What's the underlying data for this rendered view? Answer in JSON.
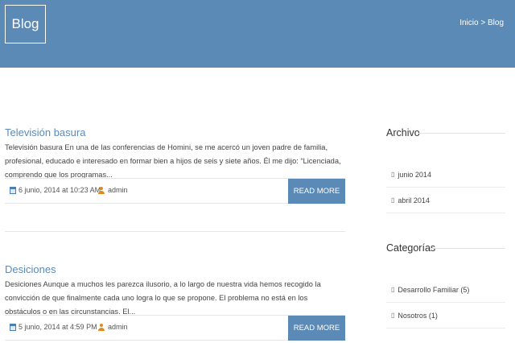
{
  "header": {
    "title": "Blog",
    "breadcrumb": {
      "home": "Inicio",
      "separator": " > ",
      "current": "Blog"
    }
  },
  "posts": [
    {
      "title": "Televisión basura",
      "excerpt": "Televisión basura En una de las conferencias de Homini, se me acercó un joven padre de familia, profesional, educado e interesado en formar bien a hijos de seis y siete años. Él me dijo: “Licenciada, comprendo que los programas...",
      "date": "6 junio, 2014 at 10:23 AM",
      "author": "admin",
      "button": "READ MORE"
    },
    {
      "title": "Desiciones",
      "excerpt": "Desiciones Aunque a muchos les parezca ilusorio, a lo largo de nuestra vida hemos recogido la convicción de que finalmente cada uno logra lo que se propone. El problema no está en los obstáculos o en las circunstancias. El...",
      "date": "5 junio, 2014 at 4:59 PM",
      "author": "admin",
      "button": "READ MORE"
    }
  ],
  "sidebar": {
    "archive": {
      "title": "Archivo",
      "items": [
        {
          "label": "junio 2014"
        },
        {
          "label": "abril 2014"
        }
      ]
    },
    "categories": {
      "title": "Categorías",
      "items": [
        {
          "label": "Desarrollo Familiar (5)"
        },
        {
          "label": "Nosotros (1)"
        }
      ]
    }
  },
  "icons": {
    "date": "calendar-icon",
    "author": "user-icon",
    "list_bullet": "square-bullet-icon"
  },
  "colors": {
    "accent": "#5b8ab7",
    "author_icon": "#e08a1e"
  }
}
